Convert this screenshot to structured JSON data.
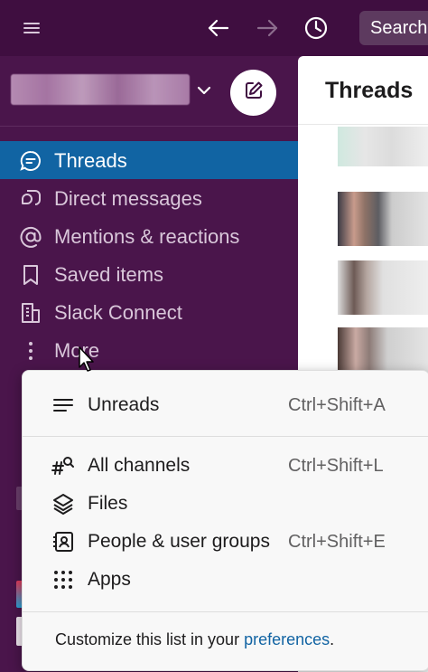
{
  "topbar": {
    "menu_icon": "hamburger-icon",
    "back_icon": "arrow-left-icon",
    "forward_icon": "arrow-right-icon",
    "history_icon": "clock-icon",
    "search_label": "Search"
  },
  "sidebar": {
    "compose_icon": "compose-icon",
    "items": [
      {
        "label": "Threads",
        "icon": "threads-icon",
        "active": true
      },
      {
        "label": "Direct messages",
        "icon": "direct-messages-icon",
        "active": false
      },
      {
        "label": "Mentions & reactions",
        "icon": "at-icon",
        "active": false
      },
      {
        "label": "Saved items",
        "icon": "bookmark-icon",
        "active": false
      },
      {
        "label": "Slack Connect",
        "icon": "building-icon",
        "active": false
      },
      {
        "label": "More",
        "icon": "more-vertical-icon",
        "active": false
      }
    ]
  },
  "main": {
    "title": "Threads"
  },
  "more_menu": {
    "items": [
      {
        "label": "Unreads",
        "shortcut": "Ctrl+Shift+A",
        "icon": "lines-icon"
      },
      {
        "label": "All channels",
        "shortcut": "Ctrl+Shift+L",
        "icon": "channel-search-icon"
      },
      {
        "label": "Files",
        "shortcut": "",
        "icon": "layers-icon"
      },
      {
        "label": "People & user groups",
        "shortcut": "Ctrl+Shift+E",
        "icon": "contact-card-icon"
      },
      {
        "label": "Apps",
        "shortcut": "",
        "icon": "grid-dots-icon"
      }
    ],
    "footer_prefix": "Customize this list in your ",
    "footer_link": "preferences",
    "footer_suffix": "."
  },
  "colors": {
    "sidebar_bg": "#4a154b",
    "topbar_bg": "#3f0e40",
    "active_item": "#1164a3",
    "link": "#1264a3"
  }
}
